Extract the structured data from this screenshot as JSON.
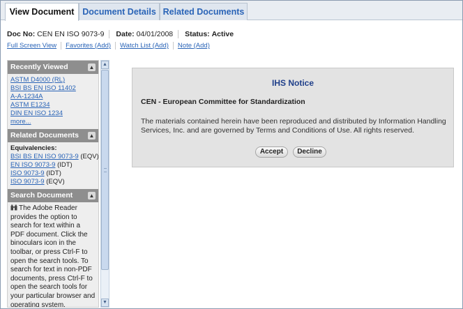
{
  "tabs": [
    {
      "label": "View Document"
    },
    {
      "label": "Document Details"
    },
    {
      "label": "Related Documents"
    }
  ],
  "doc_info": {
    "docno_label": "Doc No:",
    "docno_value": "CEN EN ISO 9073-9",
    "date_label": "Date:",
    "date_value": "04/01/2008",
    "status_label": "Status:",
    "status_value": "Active"
  },
  "links": [
    "Full Screen View",
    "Favorites (Add)",
    "Watch List (Add)",
    "Note (Add)"
  ],
  "sidebar": {
    "recently_viewed": {
      "title": "Recently Viewed",
      "items": [
        "ASTM D4000 (RL)",
        "BSI BS EN ISO 11402",
        "A-A-1234A",
        "ASTM E1234",
        "DIN EN ISO 1234",
        "more..."
      ]
    },
    "related_documents": {
      "title": "Related Documents",
      "equivalencies_label": "Equivalencies:",
      "items": [
        {
          "doc": "BSI BS EN ISO 9073-9",
          "tag": "(EQV)"
        },
        {
          "doc": "EN ISO 9073-9",
          "tag": "(IDT)"
        },
        {
          "doc": "ISO 9073-9",
          "tag": "(IDT)"
        },
        {
          "doc": "ISO 9073-9",
          "tag": "(EQV)"
        }
      ]
    },
    "search_document": {
      "title": "Search Document",
      "text": "The Adobe Reader provides the option to search for text within a PDF document. Click the binoculars icon in the toolbar, or press Ctrl-F to open the search tools. To search for text in non-PDF documents, press Ctrl-F to open the search tools for your particular browser and operating system."
    }
  },
  "notice": {
    "title": "IHS Notice",
    "subtitle": "CEN - European Committee for Standardization",
    "text": "The materials contained herein have been reproduced and distributed by Information Handling Services, Inc. and are governed by Terms and Conditions of Use. All rights reserved.",
    "accept_label": "Accept",
    "decline_label": "Decline"
  },
  "icons": {
    "collapse": "chevron-up-double-icon",
    "search": "binoculars-icon",
    "scroll_up": "arrow-up-icon",
    "scroll_down": "arrow-down-icon"
  },
  "colors": {
    "link": "#2a64b7",
    "panel_header": "#8e8e8e",
    "notice_title": "#1f3f8a"
  }
}
